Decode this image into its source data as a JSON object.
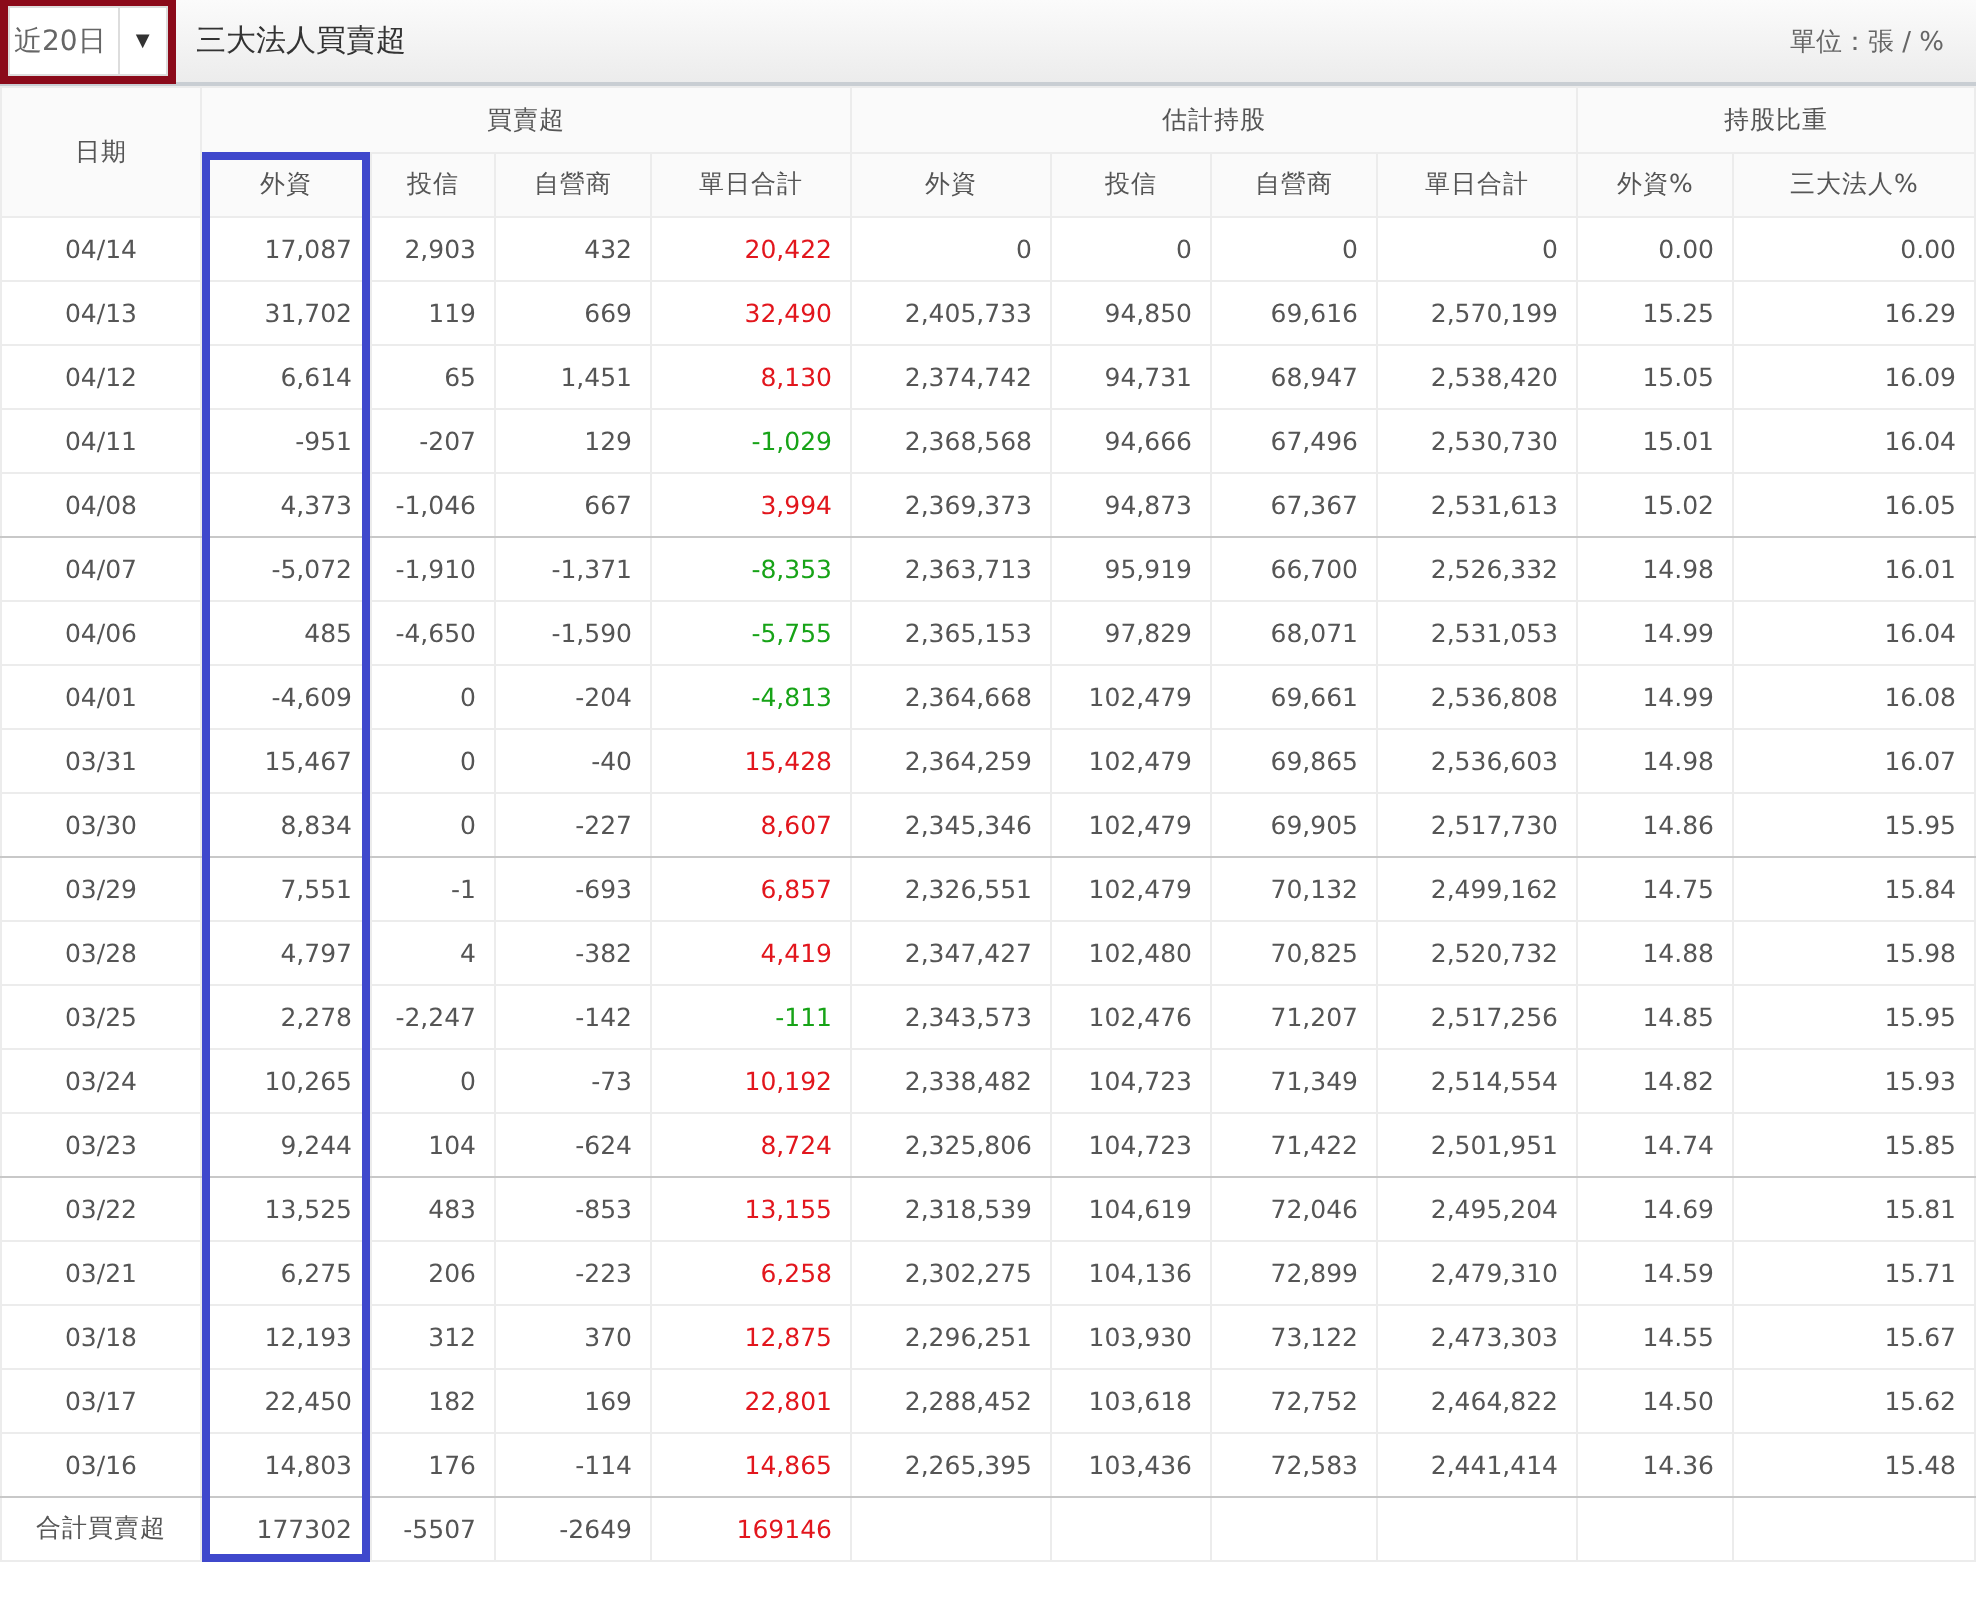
{
  "toolbar": {
    "dropdown": {
      "value": "近20日",
      "arrow": "▼",
      "highlighted": true
    },
    "title": "三大法人買賣超",
    "unit": "單位：張 / %"
  },
  "table": {
    "date_header": "日期",
    "groups": [
      {
        "label": "買賣超",
        "columns": [
          {
            "label": "外資",
            "highlighted": true
          },
          {
            "label": "投信",
            "highlighted": false
          },
          {
            "label": "自營商",
            "highlighted": false
          },
          {
            "label": "單日合計",
            "highlighted": false
          }
        ]
      },
      {
        "label": "估計持股",
        "columns": [
          {
            "label": "外資",
            "highlighted": false
          },
          {
            "label": "投信",
            "highlighted": false
          },
          {
            "label": "自營商",
            "highlighted": false
          },
          {
            "label": "單日合計",
            "highlighted": false
          }
        ]
      },
      {
        "label": "持股比重",
        "columns": [
          {
            "label": "外資%",
            "highlighted": false
          },
          {
            "label": "三大法人%",
            "highlighted": false
          }
        ]
      }
    ],
    "rows": [
      {
        "date": "04/14",
        "rising": true,
        "cells": [
          "17,087",
          "2,903",
          "432",
          "20,422",
          "0",
          "0",
          "0",
          "0",
          "0.00",
          "0.00"
        ]
      },
      {
        "date": "04/13",
        "rising": true,
        "cells": [
          "31,702",
          "119",
          "669",
          "32,490",
          "2,405,733",
          "94,850",
          "69,616",
          "2,570,199",
          "15.25",
          "16.29"
        ]
      },
      {
        "date": "04/12",
        "rising": true,
        "cells": [
          "6,614",
          "65",
          "1,451",
          "8,130",
          "2,374,742",
          "94,731",
          "68,947",
          "2,538,420",
          "15.05",
          "16.09"
        ]
      },
      {
        "date": "04/11",
        "rising": false,
        "cells": [
          "-951",
          "-207",
          "129",
          "-1,029",
          "2,368,568",
          "94,666",
          "67,496",
          "2,530,730",
          "15.01",
          "16.04"
        ]
      },
      {
        "date": "04/08",
        "rising": true,
        "cells": [
          "4,373",
          "-1,046",
          "667",
          "3,994",
          "2,369,373",
          "94,873",
          "67,367",
          "2,531,613",
          "15.02",
          "16.05"
        ]
      },
      {
        "date": "04/07",
        "rising": false,
        "cells": [
          "-5,072",
          "-1,910",
          "-1,371",
          "-8,353",
          "2,363,713",
          "95,919",
          "66,700",
          "2,526,332",
          "14.98",
          "16.01"
        ]
      },
      {
        "date": "04/06",
        "rising": false,
        "cells": [
          "485",
          "-4,650",
          "-1,590",
          "-5,755",
          "2,365,153",
          "97,829",
          "68,071",
          "2,531,053",
          "14.99",
          "16.04"
        ]
      },
      {
        "date": "04/01",
        "rising": false,
        "cells": [
          "-4,609",
          "0",
          "-204",
          "-4,813",
          "2,364,668",
          "102,479",
          "69,661",
          "2,536,808",
          "14.99",
          "16.08"
        ]
      },
      {
        "date": "03/31",
        "rising": true,
        "cells": [
          "15,467",
          "0",
          "-40",
          "15,428",
          "2,364,259",
          "102,479",
          "69,865",
          "2,536,603",
          "14.98",
          "16.07"
        ]
      },
      {
        "date": "03/30",
        "rising": true,
        "cells": [
          "8,834",
          "0",
          "-227",
          "8,607",
          "2,345,346",
          "102,479",
          "69,905",
          "2,517,730",
          "14.86",
          "15.95"
        ]
      },
      {
        "date": "03/29",
        "rising": true,
        "cells": [
          "7,551",
          "-1",
          "-693",
          "6,857",
          "2,326,551",
          "102,479",
          "70,132",
          "2,499,162",
          "14.75",
          "15.84"
        ]
      },
      {
        "date": "03/28",
        "rising": true,
        "cells": [
          "4,797",
          "4",
          "-382",
          "4,419",
          "2,347,427",
          "102,480",
          "70,825",
          "2,520,732",
          "14.88",
          "15.98"
        ]
      },
      {
        "date": "03/25",
        "rising": false,
        "cells": [
          "2,278",
          "-2,247",
          "-142",
          "-111",
          "2,343,573",
          "102,476",
          "71,207",
          "2,517,256",
          "14.85",
          "15.95"
        ]
      },
      {
        "date": "03/24",
        "rising": true,
        "cells": [
          "10,265",
          "0",
          "-73",
          "10,192",
          "2,338,482",
          "104,723",
          "71,349",
          "2,514,554",
          "14.82",
          "15.93"
        ]
      },
      {
        "date": "03/23",
        "rising": true,
        "cells": [
          "9,244",
          "104",
          "-624",
          "8,724",
          "2,325,806",
          "104,723",
          "71,422",
          "2,501,951",
          "14.74",
          "15.85"
        ]
      },
      {
        "date": "03/22",
        "rising": true,
        "cells": [
          "13,525",
          "483",
          "-853",
          "13,155",
          "2,318,539",
          "104,619",
          "72,046",
          "2,495,204",
          "14.69",
          "15.81"
        ]
      },
      {
        "date": "03/21",
        "rising": true,
        "cells": [
          "6,275",
          "206",
          "-223",
          "6,258",
          "2,302,275",
          "104,136",
          "72,899",
          "2,479,310",
          "14.59",
          "15.71"
        ]
      },
      {
        "date": "03/18",
        "rising": true,
        "cells": [
          "12,193",
          "312",
          "370",
          "12,875",
          "2,296,251",
          "103,930",
          "73,122",
          "2,473,303",
          "14.55",
          "15.67"
        ]
      },
      {
        "date": "03/17",
        "rising": true,
        "cells": [
          "22,450",
          "182",
          "169",
          "22,801",
          "2,288,452",
          "103,618",
          "72,752",
          "2,464,822",
          "14.50",
          "15.62"
        ]
      },
      {
        "date": "03/16",
        "rising": true,
        "cells": [
          "14,803",
          "176",
          "-114",
          "14,865",
          "2,265,395",
          "103,436",
          "72,583",
          "2,441,414",
          "14.36",
          "15.48"
        ]
      }
    ],
    "total": {
      "label": "合計買賣超",
      "rising": true,
      "cells": [
        "177302",
        "-5507",
        "-2649",
        "169146"
      ]
    }
  }
}
